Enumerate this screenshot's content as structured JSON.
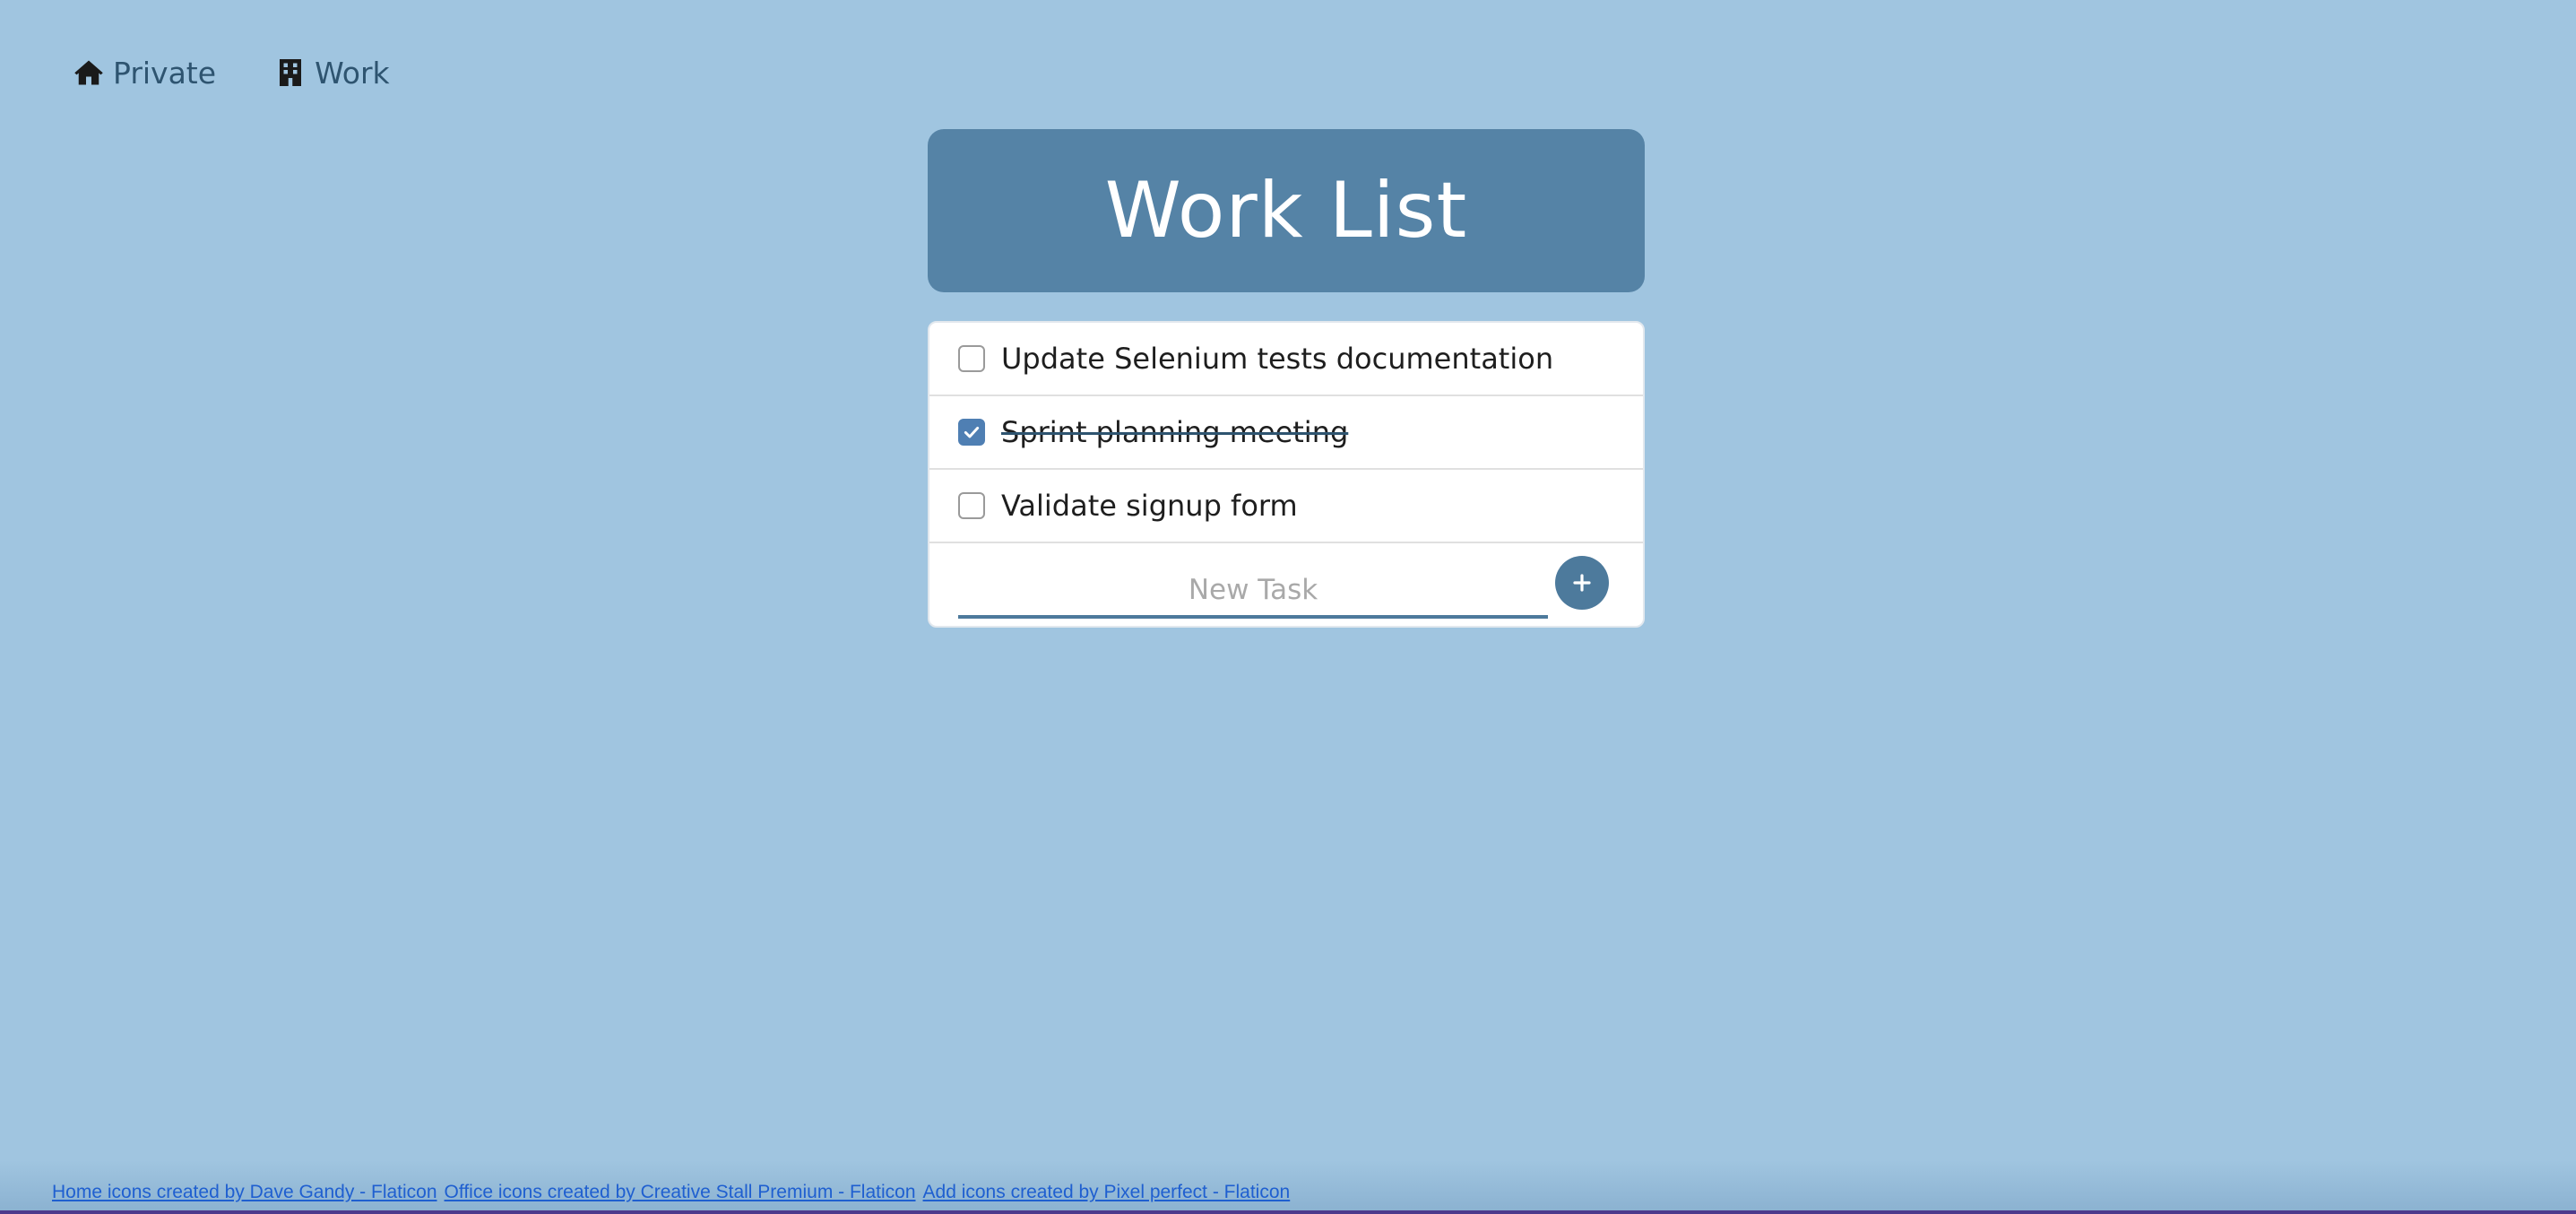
{
  "nav": {
    "items": [
      {
        "label": "Private",
        "icon": "home-icon"
      },
      {
        "label": "Work",
        "icon": "office-building-icon"
      }
    ]
  },
  "header": {
    "title": "Work List"
  },
  "tasks": [
    {
      "text": "Update Selenium tests documentation",
      "done": false
    },
    {
      "text": "Sprint planning meeting",
      "done": true
    },
    {
      "text": "Validate signup form",
      "done": false
    }
  ],
  "new_task": {
    "placeholder": "New Task",
    "value": "",
    "add_icon": "plus-icon"
  },
  "footer": {
    "links": [
      "Home icons created by Dave Gandy - Flaticon",
      "Office icons created by Creative Stall Premium - Flaticon",
      "Add icons created by Pixel perfect - Flaticon"
    ]
  },
  "colors": {
    "background": "#a0c5e0",
    "header_bg": "#5583a6",
    "accent": "#4d7a9c",
    "checkbox_checked": "#4f7fb3",
    "link": "#1f5fd0"
  }
}
